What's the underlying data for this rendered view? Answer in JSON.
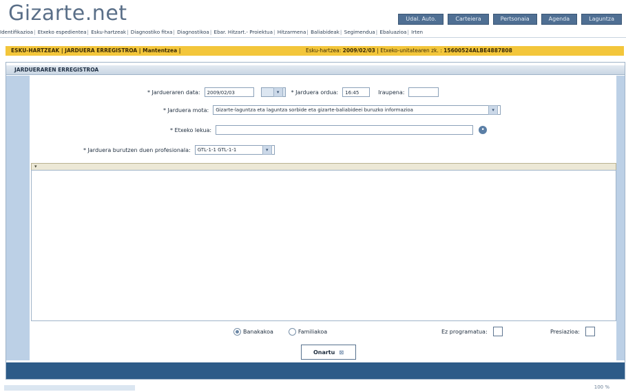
{
  "header": {
    "logo": "Gizarte.net",
    "nav": [
      "Udal. Auto.",
      "Carteiera",
      "Pertsonaia",
      "Agenda",
      "Laguntza"
    ]
  },
  "tabs": [
    "Identifikazioa",
    "Etxeko espedientea",
    "Esku-hartzeak",
    "Diagnostiko fitxa",
    "Diagnostikoa",
    "Ebar. Hitzart.- Proiektua",
    "Hitzarmena",
    "Baliabideak",
    "Segimendua",
    "Ebaluazioa",
    "Irten"
  ],
  "context_bar": {
    "left": "ESKU-HARTZEAK | JARDUERA ERREGISTROA | Mantentzea |",
    "right_label": "Esku-hartzea:",
    "right_value": "2009/02/03",
    "right_extra": "| Etxeko-unitatearen zk. :",
    "right_id": "15600524ALBE4887808"
  },
  "section": {
    "title": "JARDUERAREN ERREGISTROA"
  },
  "form": {
    "date_label": "* Jardueraren data:",
    "date_value": "2009/02/03",
    "hour_label": "* Jarduera ordua:",
    "hour_value": "16:45",
    "duration_label": "Iraupena:",
    "duration_value": "",
    "mode_label": "* Jarduera mota:",
    "mode_value": "Gizarte-laguntza eta laguntza sorbide eta gizarte-baliabideei buruzko informazioa",
    "other_label": "* Etxeko lekua:",
    "other_value": "",
    "professional_label": "* Jarduera burutzen duen profesionala:",
    "professional_value": "GTL-1-1 GTL-1-1"
  },
  "memo": {
    "text": ""
  },
  "bottom": {
    "radio_individual": "Banakakoa",
    "radio_family": "Familiakoa",
    "not_scheduled": "Ez programatua:",
    "preliminary": "Presiazioa:",
    "accept": "Onartu"
  },
  "status": {
    "right": "100 %"
  }
}
